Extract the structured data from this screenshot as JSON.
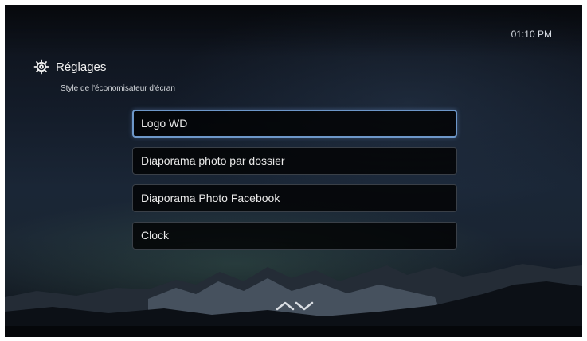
{
  "status_bar": {
    "time": "01:10 PM"
  },
  "header": {
    "title": "Réglages",
    "subtitle": "Style de l'économisateur d'écran",
    "icon": "gear-icon"
  },
  "menu": {
    "selected_index": 0,
    "items": [
      {
        "label": "Logo WD"
      },
      {
        "label": "Diaporama photo par dossier"
      },
      {
        "label": "Diaporama Photo Facebook"
      },
      {
        "label": "Clock"
      }
    ]
  },
  "navigation": {
    "icon": "up-down-chevrons-icon"
  },
  "colors": {
    "selection_border": "#6d97c9",
    "item_background": "#000000"
  }
}
